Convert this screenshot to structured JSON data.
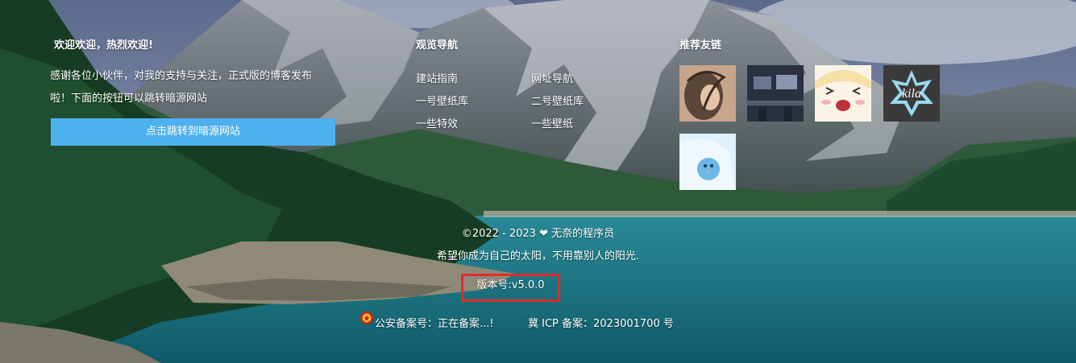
{
  "about": {
    "title": "欢迎欢迎，热烈欢迎!",
    "line1": "感谢各位小伙伴，对我的支持与关注，正式版的博客发布",
    "line2": "啦！下面的按钮可以跳转暗源网站",
    "button_label": "点击跳转到暗源网站"
  },
  "nav": {
    "title": "观览导航",
    "links": [
      "建站指南",
      "网址导航",
      "一号壁纸库",
      "二号壁纸库",
      "一些特效",
      "一些壁纸"
    ]
  },
  "friends": {
    "title": "推荐友链",
    "items": [
      {
        "name": "friend-avatar-portrait",
        "colors": [
          "#5a4638",
          "#c7a58b"
        ]
      },
      {
        "name": "friend-avatar-desk",
        "colors": [
          "#2b3040",
          "#6c7690"
        ]
      },
      {
        "name": "friend-avatar-anime",
        "colors": [
          "#f5e7c8",
          "#f2b2b8"
        ]
      },
      {
        "name": "friend-avatar-kila",
        "colors": [
          "#3a3a3a",
          "#9ad8f0"
        ],
        "logo_text": "kila"
      },
      {
        "name": "friend-avatar-bird",
        "colors": [
          "#dff1fb",
          "#6cb8e8"
        ]
      }
    ]
  },
  "footer": {
    "copyright_prefix": "©2022 - 2023",
    "heart_icon": "heart-icon",
    "author": "无奈的程序员",
    "motto": "希望你成为自己的太阳，不用靠别人的阳光.",
    "version": "版本号:v5.0.0",
    "police_record": "公安备案号：正在备案...!",
    "icp_record": "冀 ICP 备案：2023001700 号",
    "highlight_color": "#e02a2a",
    "button_color": "#4fb0f0"
  }
}
